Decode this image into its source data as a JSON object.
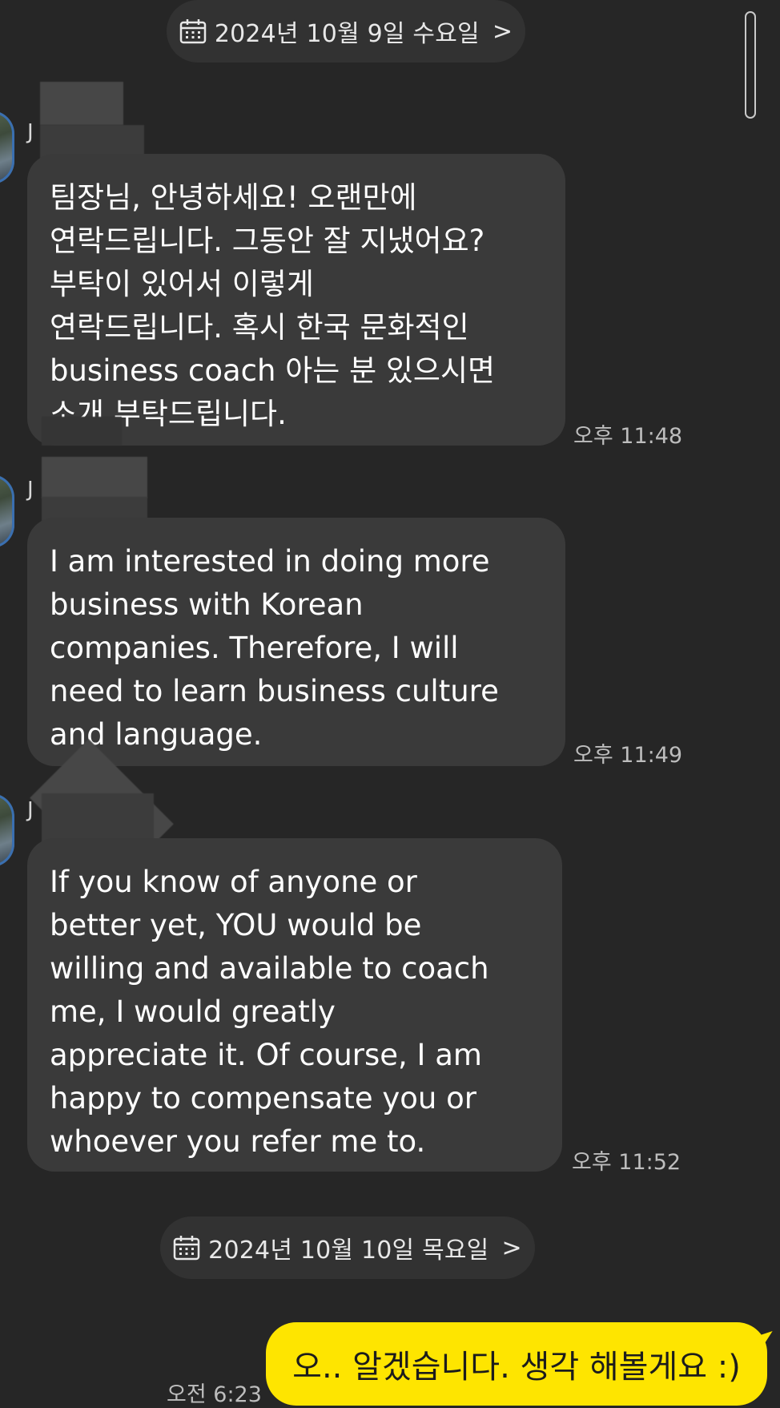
{
  "dates": [
    {
      "label": "2024년 10월 9일 수요일",
      "chevron": ">"
    },
    {
      "label": "2024년 10월 10일 목요일",
      "chevron": ">"
    }
  ],
  "messages": [
    {
      "sender": "J",
      "text": "팀장님, 안녕하세요! 오랜만에\n연락드립니다. 그동안 잘 지냈어요?\n부탁이 있어서 이렇게\n연락드립니다. 혹시 한국 문화적인\nbusiness coach 아는 분 있으시면\n소개 부탁드립니다.",
      "time": "오후 11:48"
    },
    {
      "sender": "J",
      "text": "I am interested in doing more\nbusiness with Korean\ncompanies. Therefore, I will\nneed to learn business culture\nand language.",
      "time": "오후 11:49"
    },
    {
      "sender": "J",
      "text": "If you know of anyone or\nbetter yet, YOU would be\nwilling and available to coach\nme, I would greatly\nappreciate it. Of course, I am\nhappy to compensate you or\nwhoever you refer me to.",
      "time": "오후 11:52"
    }
  ],
  "reply": {
    "text": "오.. 알겠습니다. 생각 해볼게요 :)",
    "time": "오전 6:23"
  },
  "colors": {
    "background": "#262626",
    "bubble_in": "#3a3a3a",
    "bubble_out": "#fee500",
    "date_pill": "#323232"
  },
  "icons": {
    "calendar": "calendar-icon",
    "chevron": "chevron-right-icon"
  }
}
